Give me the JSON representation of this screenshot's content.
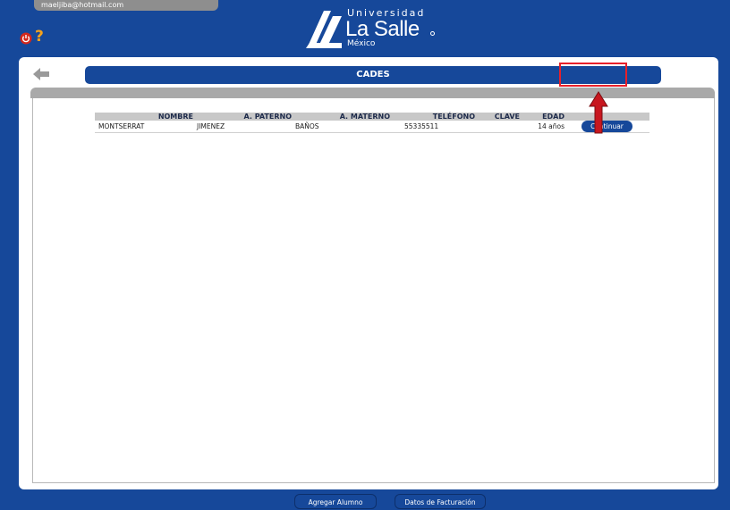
{
  "header": {
    "email": "maeljiba@hotmail.com",
    "help_label": "?",
    "logo": {
      "line1": "Universidad",
      "line2": "La Salle",
      "line3": "México"
    }
  },
  "page": {
    "title": "CADES"
  },
  "table": {
    "columns": [
      "NOMBRE",
      "A. PATERNO",
      "A. MATERNO",
      "TELÉFONO",
      "CLAVE",
      "EDAD"
    ],
    "rows": [
      {
        "nombre": "MONTSERRAT",
        "paterno": "JIMENEZ",
        "materno": "BAÑOS",
        "telefono": "55335511",
        "clave": "",
        "edad": "14 años",
        "action": "Continuar"
      }
    ]
  },
  "footer": {
    "agregar_label": "Agregar Alumno",
    "datos_label": "Datos de Facturación"
  },
  "colors": {
    "brand_blue": "#16489a",
    "highlight_red": "#e8202a",
    "help_orange": "#f5a21b"
  },
  "icons": [
    "power-icon",
    "help-icon",
    "back-arrow-icon",
    "red-up-arrow"
  ]
}
